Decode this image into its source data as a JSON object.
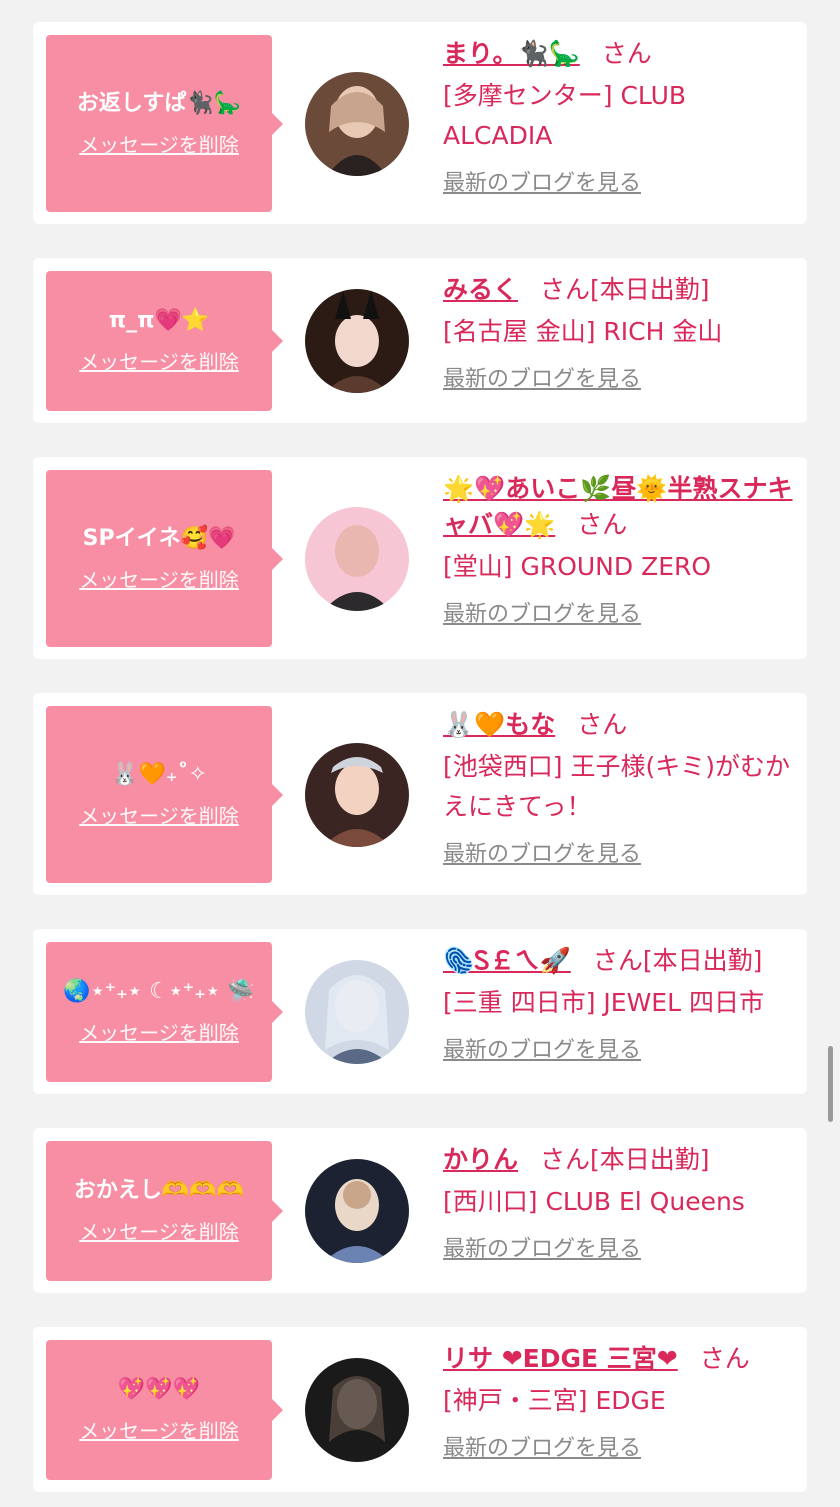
{
  "ui": {
    "delete_label": "メッセージを削除",
    "blog_label": "最新のブログを見る",
    "san_suffix": "さん"
  },
  "messages": [
    {
      "bubble_text": "お返しすぱ🐈‍⬛🦕",
      "name": "まり。🐈‍⬛🦕",
      "badge": "",
      "shop": "[多摩センター] CLUB ALCADIA",
      "avatar_colors": [
        "#6b4a3a",
        "#e8c9b4",
        "#2a2220"
      ]
    },
    {
      "bubble_text": "π_π💗⭐",
      "name": "みるく",
      "badge": "[本日出勤]",
      "shop": "[名古屋 金山] RICH 金山",
      "avatar_colors": [
        "#2b1b14",
        "#f2d8cc",
        "#5a3b2e"
      ]
    },
    {
      "bubble_text": "SPイイネ🥰💗",
      "name": "🌟💖あいこ🌿昼🌞半熟スナキャバ💖🌟",
      "badge": "",
      "shop": "[堂山] GROUND ZERO",
      "avatar_colors": [
        "#f7c6d4",
        "#e9b7b0",
        "#2c2a2c"
      ]
    },
    {
      "bubble_text": "🐰🧡₊˚✧",
      "name": "🐰🧡もな",
      "badge": "",
      "shop": "[池袋西口] 王子様(キミ)がむかえにきてっ！",
      "avatar_colors": [
        "#3a2522",
        "#f4d2c2",
        "#7a4a3c"
      ]
    },
    {
      "bubble_text": "🌏⋆⁺₊⋆ ☾⋆⁺₊⋆ 🛸",
      "name": "🫆Ꮪ￡ㄟ🚀",
      "badge": "[本日出勤]",
      "shop": "[三重 四日市] JEWEL 四日市",
      "avatar_colors": [
        "#cfd8e4",
        "#f3e9ea",
        "#5a6a86"
      ]
    },
    {
      "bubble_text": "おかえし🫶🫶🫶",
      "name": "かりん",
      "badge": "[本日出勤]",
      "shop": "[西川口] CLUB El Queens",
      "avatar_colors": [
        "#1d2233",
        "#6b83b3",
        "#e9d8c8"
      ]
    },
    {
      "bubble_text": "💖💖💖",
      "name": "リサ ❤EDGE 三宮❤",
      "badge": "",
      "shop": "[神戸・三宮] EDGE",
      "avatar_colors": [
        "#1a1a1a",
        "#cfc2bb",
        "#55483f"
      ]
    }
  ]
}
